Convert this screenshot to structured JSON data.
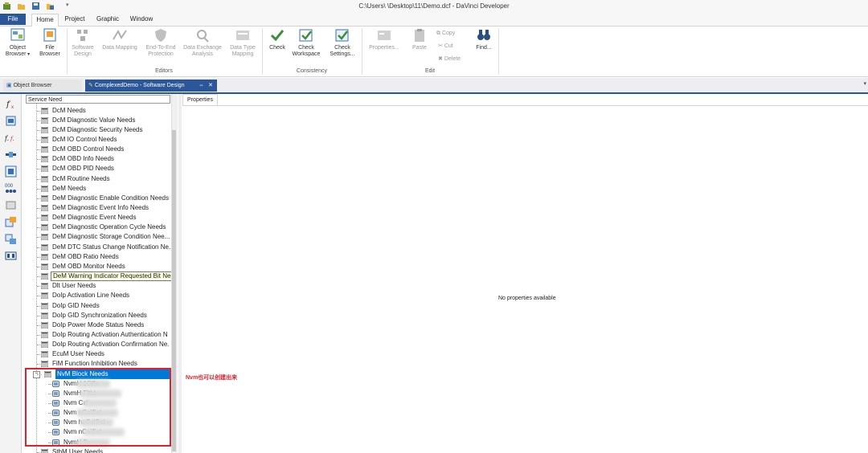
{
  "window": {
    "title": "C:\\Users\\          \\Desktop\\11\\Demo.dcf - DaVinci Developer"
  },
  "menu": {
    "tabs": [
      "File",
      "Home",
      "Project",
      "Graphic",
      "Window"
    ]
  },
  "ribbon": {
    "buttons": {
      "object_browser": [
        "Object",
        "Browser"
      ],
      "file_browser": [
        "File",
        "Browser"
      ],
      "software_design": [
        "Software",
        "Design"
      ],
      "data_mapping": "Data Mapping",
      "e2e_protection": [
        "End-To-End",
        "Protection"
      ],
      "data_exchange": [
        "Data Exchange",
        "Analysis"
      ],
      "data_type_mapping": [
        "Data Type",
        "Mapping"
      ],
      "check": "Check",
      "check_workspace": [
        "Check",
        "Workspace"
      ],
      "check_settings": [
        "Check",
        "Settings..."
      ],
      "properties": "Properties...",
      "paste": "Paste",
      "copy": "Copy",
      "cut": "Cut",
      "delete": "Delete",
      "find": "Find..."
    },
    "groups": {
      "editors": "Editors",
      "consistency": "Consistency",
      "edit": "Edit"
    }
  },
  "doc_tabs": {
    "object_browser": "Object Browser",
    "active": "ComplexedDemo - Software Design",
    "pin": "⇔",
    "close": "✕"
  },
  "tree": {
    "header": "Service Need",
    "items": [
      "DcM Needs",
      "DcM Diagnostic Value Needs",
      "DcM Diagnostic Security Needs",
      "DcM IO Control Needs",
      "DcM OBD Control Needs",
      "DcM OBD Info Needs",
      "DcM OBD PID Needs",
      "DcM Routine Needs",
      "DeM Needs",
      "DeM Diagnostic Enable Condition Needs",
      "DeM Diagnostic Event Info Needs",
      "DeM Diagnostic Event Needs",
      "DeM Diagnostic Operation Cycle Needs",
      "DeM Diagnostic Storage Condition Nee...",
      "DeM DTC Status Change Notification Ne...",
      "DeM OBD Ratio Needs",
      "DeM OBD Monitor Needs",
      "DeM Warning Indicator Requested Bit Needs",
      "Dlt User Needs",
      "DoIp Activation Line Needs",
      "DoIp GID Needs",
      "DoIp GID Synchronization Needs",
      "DoIp Power Mode Status Needs",
      "DoIp Routing Activation Authentication N",
      "DoIp Routing Activation Confirmation Ne.",
      "EcuM User Needs",
      "FiM Function Inhibition Needs"
    ],
    "selected": "NvM Block Needs",
    "children": [
      "NvmH        1Offs",
      "NvmH        FltLt",
      "Nvm             Cal",
      "Nvm             nCalSet",
      "Nvm             haCalSet",
      "Nvm             nCalSet",
      "NvmH            ffs"
    ],
    "after": "StbM User Needs"
  },
  "properties": {
    "tab": "Properties",
    "empty": "No properties available"
  },
  "annotation": "Nvm也可以创建出来",
  "colors": {
    "accent": "#2b579a",
    "highlight": "#e0202a",
    "selection": "#0078d7"
  }
}
